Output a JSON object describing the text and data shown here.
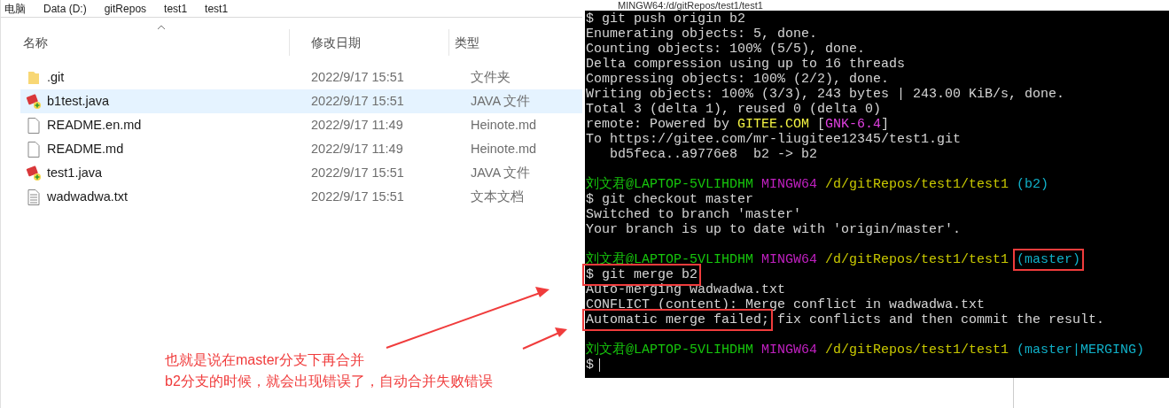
{
  "explorer": {
    "breadcrumb": [
      "电脑",
      "Data (D:)",
      "gitRepos",
      "test1",
      "test1"
    ],
    "columns": [
      "名称",
      "修改日期",
      "类型"
    ],
    "files": [
      {
        "name": ".git",
        "modified": "2022/9/17 15:51",
        "type": "文件夹",
        "kind": "folder",
        "selected": false
      },
      {
        "name": "b1test.java",
        "modified": "2022/9/17 15:51",
        "type": "JAVA 文件",
        "kind": "java",
        "selected": true
      },
      {
        "name": "README.en.md",
        "modified": "2022/9/17 11:49",
        "type": "Heinote.md",
        "kind": "blank",
        "selected": false
      },
      {
        "name": "README.md",
        "modified": "2022/9/17 11:49",
        "type": "Heinote.md",
        "kind": "blank",
        "selected": false
      },
      {
        "name": "test1.java",
        "modified": "2022/9/17 15:51",
        "type": "JAVA 文件",
        "kind": "java",
        "selected": false
      },
      {
        "name": "wadwadwa.txt",
        "modified": "2022/9/17 15:51",
        "type": "文本文档",
        "kind": "text",
        "selected": false
      }
    ]
  },
  "terminal": {
    "title": "MINGW64:/d/gitRepos/test1/test1",
    "lines": [
      {
        "gap_before": false,
        "segments": [
          {
            "text": "$ git push origin b2",
            "boxed": false
          }
        ]
      },
      {
        "gap_before": false,
        "segments": [
          {
            "text": "Enumerating objects: 5, done.",
            "boxed": false
          }
        ]
      },
      {
        "gap_before": false,
        "segments": [
          {
            "text": "Counting objects: 100% (5/5), done.",
            "boxed": false
          }
        ]
      },
      {
        "gap_before": false,
        "segments": [
          {
            "text": "Delta compression using up to 16 threads",
            "boxed": false
          }
        ]
      },
      {
        "gap_before": false,
        "segments": [
          {
            "text": "Compressing objects: 100% (2/2), done.",
            "boxed": false
          }
        ]
      },
      {
        "gap_before": false,
        "segments": [
          {
            "text": "Writing objects: 100% (3/3), 243 bytes | 243.00 KiB/s, done.",
            "boxed": false
          }
        ]
      },
      {
        "gap_before": false,
        "segments": [
          {
            "text": "Total 3 (delta 1), reused 0 (delta 0)",
            "boxed": false
          }
        ]
      },
      {
        "gap_before": false,
        "segments": [
          {
            "text": "remote: Powered by ",
            "boxed": false
          },
          {
            "text": "GITEE.COM",
            "color": "#f5f543",
            "boxed": false
          },
          {
            "text": " [",
            "boxed": false
          },
          {
            "text": "GNK-6.4",
            "color": "#e040e0",
            "boxed": false
          },
          {
            "text": "]",
            "boxed": false
          }
        ]
      },
      {
        "gap_before": false,
        "segments": [
          {
            "text": "To https://gitee.com/mr-liugitee12345/test1.git",
            "boxed": false
          }
        ]
      },
      {
        "gap_before": false,
        "segments": [
          {
            "text": "   bd5feca..a9776e8  b2 -> b2",
            "boxed": false
          }
        ]
      },
      {
        "gap_before": true,
        "segments": [
          {
            "text": "刘文君@LAPTOP-5VLIHDHM ",
            "color": "#16c60c",
            "boxed": false
          },
          {
            "text": "MINGW64 ",
            "color": "#c020c0",
            "boxed": false
          },
          {
            "text": "/d/gitRepos/test1/test1 ",
            "color": "#c8c800",
            "boxed": false
          },
          {
            "text": "(b2)",
            "color": "#10b0c8",
            "boxed": false
          }
        ]
      },
      {
        "gap_before": false,
        "segments": [
          {
            "text": "$ git checkout master",
            "boxed": false
          }
        ]
      },
      {
        "gap_before": false,
        "segments": [
          {
            "text": "Switched to branch 'master'",
            "boxed": false
          }
        ]
      },
      {
        "gap_before": false,
        "segments": [
          {
            "text": "Your branch is up to date with 'origin/master'.",
            "boxed": false
          }
        ]
      },
      {
        "gap_before": true,
        "segments": [
          {
            "text": "刘文君@LAPTOP-5VLIHDHM ",
            "color": "#16c60c",
            "boxed": false
          },
          {
            "text": "MINGW64 ",
            "color": "#c020c0",
            "boxed": false
          },
          {
            "text": "/d/gitRepos/test1/test1 ",
            "color": "#c8c800",
            "boxed": false
          },
          {
            "text": "(master)",
            "color": "#10b0c8",
            "boxed": true
          }
        ]
      },
      {
        "gap_before": false,
        "segments": [
          {
            "text": "$ git merge b2",
            "boxed": true
          }
        ]
      },
      {
        "gap_before": false,
        "segments": [
          {
            "text": "Auto-merging wadwadwa.txt",
            "boxed": false
          }
        ]
      },
      {
        "gap_before": false,
        "segments": [
          {
            "text": "CONFLICT (content): Merge conflict in wadwadwa.txt",
            "boxed": false
          }
        ]
      },
      {
        "gap_before": false,
        "segments": [
          {
            "text": "Automatic merge failed;",
            "boxed": true
          },
          {
            "text": " fix conflicts and then commit the result.",
            "boxed": false
          }
        ]
      },
      {
        "gap_before": true,
        "segments": [
          {
            "text": "刘文君@LAPTOP-5VLIHDHM ",
            "color": "#16c60c",
            "boxed": false
          },
          {
            "text": "MINGW64 ",
            "color": "#c020c0",
            "boxed": false
          },
          {
            "text": "/d/gitRepos/test1/test1 ",
            "color": "#c8c800",
            "boxed": false
          },
          {
            "text": "(master|MERGING)",
            "color": "#10b0c8",
            "boxed": false
          }
        ]
      },
      {
        "gap_before": false,
        "segments": [
          {
            "text": "$",
            "boxed": false
          }
        ]
      }
    ],
    "cursor": true
  },
  "annotation": {
    "lines": [
      "也就是说在master分支下再合并",
      "b2分支的时候，就会出现错误了，自动合并失败错误"
    ]
  }
}
